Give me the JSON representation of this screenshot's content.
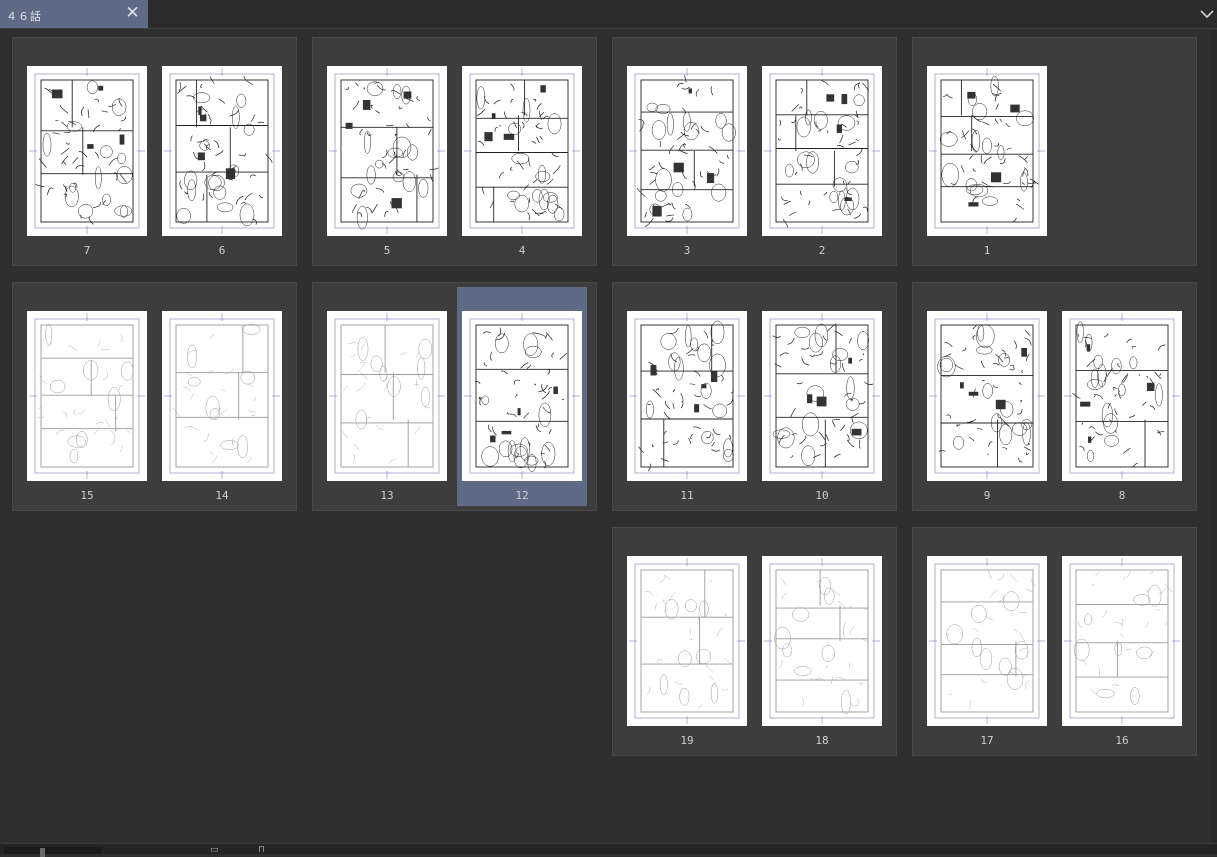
{
  "window": {
    "tab_title": "４６話",
    "close_icon": "close-icon",
    "menu_icon": "chevron-down-icon"
  },
  "colors": {
    "background": "#2f2f2f",
    "spread": "#3d3d3d",
    "tab_active": "#5f6a86",
    "selection": "#5f6a86",
    "page_number": "#cfcfcf"
  },
  "spreads": [
    {
      "row": 0,
      "col": 0,
      "pages": [
        {
          "number": "7",
          "style": "ink"
        },
        {
          "number": "6",
          "style": "ink"
        }
      ]
    },
    {
      "row": 0,
      "col": 1,
      "pages": [
        {
          "number": "5",
          "style": "ink"
        },
        {
          "number": "4",
          "style": "ink"
        }
      ]
    },
    {
      "row": 0,
      "col": 2,
      "pages": [
        {
          "number": "3",
          "style": "ink"
        },
        {
          "number": "2",
          "style": "ink"
        }
      ]
    },
    {
      "row": 0,
      "col": 3,
      "pages": [
        {
          "number": "1",
          "style": "ink"
        }
      ]
    },
    {
      "row": 1,
      "col": 0,
      "pages": [
        {
          "number": "15",
          "style": "sketch"
        },
        {
          "number": "14",
          "style": "sketch"
        }
      ]
    },
    {
      "row": 1,
      "col": 1,
      "pages": [
        {
          "number": "13",
          "style": "sketch"
        },
        {
          "number": "12",
          "style": "ink",
          "selected": true
        }
      ]
    },
    {
      "row": 1,
      "col": 2,
      "pages": [
        {
          "number": "11",
          "style": "ink"
        },
        {
          "number": "10",
          "style": "ink"
        }
      ]
    },
    {
      "row": 1,
      "col": 3,
      "pages": [
        {
          "number": "9",
          "style": "ink"
        },
        {
          "number": "8",
          "style": "ink"
        }
      ]
    },
    {
      "row": 2,
      "col": 2,
      "pages": [
        {
          "number": "19",
          "style": "sketch"
        },
        {
          "number": "18",
          "style": "sketch"
        }
      ]
    },
    {
      "row": 2,
      "col": 3,
      "pages": [
        {
          "number": "17",
          "style": "sketch"
        },
        {
          "number": "16",
          "style": "sketch"
        }
      ]
    }
  ],
  "bottom_bar": {
    "zoom_slider_icon": "zoom-slider",
    "page_view_icon": "page-view-icon",
    "book_icon": "book-icon"
  }
}
